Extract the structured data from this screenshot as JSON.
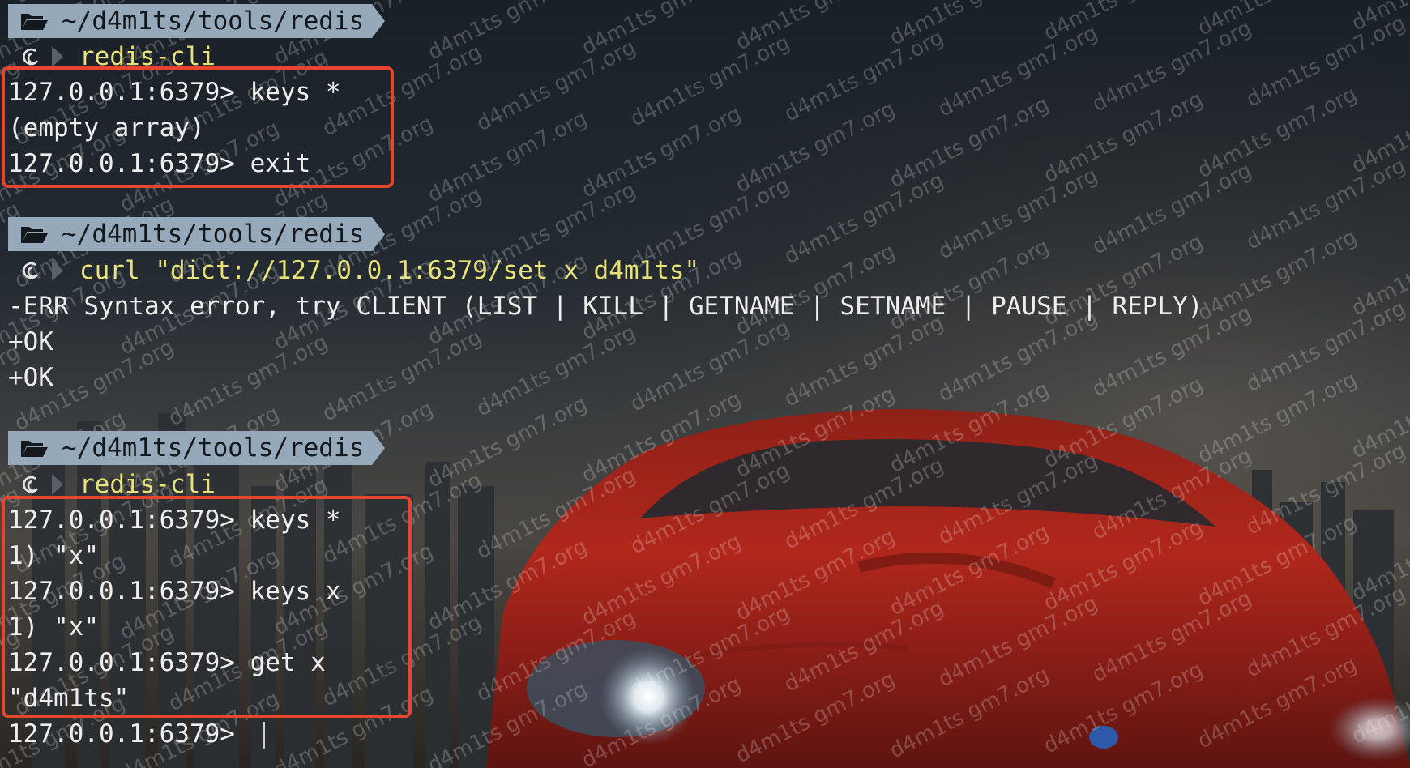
{
  "terminal": {
    "blocks": [
      {
        "path": "~/d4m1ts/tools/redis",
        "command": "redis-cli",
        "output": [
          "127.0.0.1:6379> keys *",
          "(empty array)",
          "127.0.0.1:6379> exit"
        ]
      },
      {
        "path": "~/d4m1ts/tools/redis",
        "command": "curl \"dict://127.0.0.1:6379/set x d4m1ts\"",
        "output": [
          "-ERR Syntax error, try CLIENT (LIST | KILL | GETNAME | SETNAME | PAUSE | REPLY)",
          "+OK",
          "+OK"
        ]
      },
      {
        "path": "~/d4m1ts/tools/redis",
        "command": "redis-cli",
        "output": [
          "127.0.0.1:6379> keys *",
          "1) \"x\"",
          "127.0.0.1:6379> keys x",
          "1) \"x\"",
          "127.0.0.1:6379> get x",
          "\"d4m1ts\""
        ],
        "active_prompt": "127.0.0.1:6379> "
      }
    ]
  },
  "watermark": {
    "text": "d4m1ts gm7.org"
  },
  "colors": {
    "highlight_box": "#e8452f",
    "path_segment_bg": "#96a9ba",
    "command_text": "#e9e27a",
    "output_text": "#eeeeee",
    "car_red": "#b1271c"
  },
  "icons": {
    "path_icon": "folder-open-icon",
    "prompt_icon": "debian-swirl-icon",
    "separator_icon": "powerline-chevron-icon"
  }
}
